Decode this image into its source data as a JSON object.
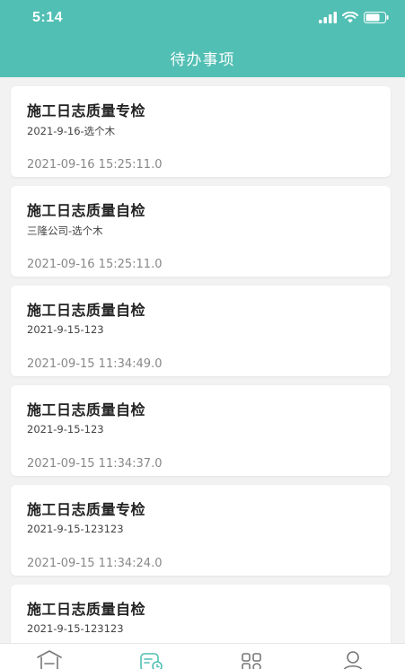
{
  "status_bar": {
    "time": "5:14"
  },
  "header": {
    "title": "待办事项"
  },
  "items": [
    {
      "title": "施工日志质量专检",
      "subtitle": "2021-9-16-选个木",
      "timestamp": "2021-09-16 15:25:11.0"
    },
    {
      "title": "施工日志质量自检",
      "subtitle": "三隆公司-选个木",
      "timestamp": "2021-09-16 15:25:11.0"
    },
    {
      "title": "施工日志质量自检",
      "subtitle": "2021-9-15-123",
      "timestamp": "2021-09-15 11:34:49.0"
    },
    {
      "title": "施工日志质量自检",
      "subtitle": "2021-9-15-123",
      "timestamp": "2021-09-15 11:34:37.0"
    },
    {
      "title": "施工日志质量专检",
      "subtitle": "2021-9-15-123123",
      "timestamp": "2021-09-15 11:34:24.0"
    },
    {
      "title": "施工日志质量自检",
      "subtitle": "2021-9-15-123123",
      "timestamp": ""
    }
  ],
  "tabbar": {
    "tabs": [
      {
        "icon": "home-icon",
        "active": false
      },
      {
        "icon": "todo-icon",
        "active": true
      },
      {
        "icon": "apps-icon",
        "active": false
      },
      {
        "icon": "user-icon",
        "active": false
      }
    ]
  },
  "colors": {
    "primary": "#52bfb4",
    "inactive_icon": "#777777"
  }
}
